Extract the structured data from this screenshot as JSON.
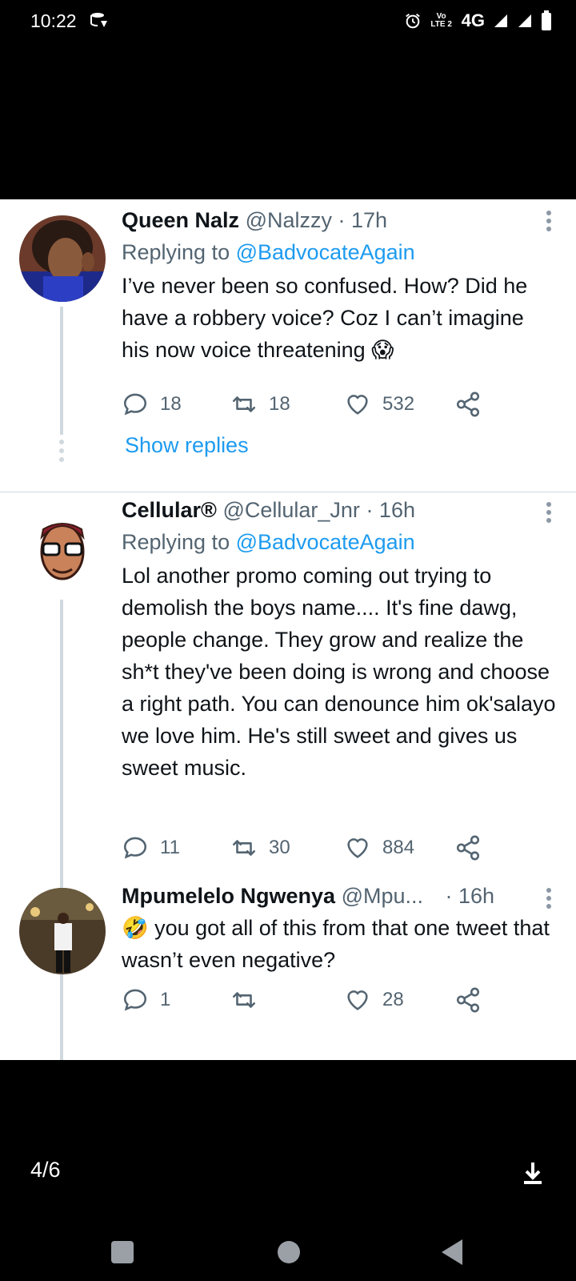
{
  "status_bar": {
    "time": "10:22",
    "volte_label": "Vo LTE 2",
    "network": "4G"
  },
  "tweets": [
    {
      "name": "Queen Nalz",
      "handle": "@Nalzzy",
      "time": "· 17h",
      "replying_prefix": "Replying to",
      "replying_handle": "@BadvocateAgain",
      "text": "I’ve never been so confused. How? Did he have a robbery voice? Coz I can’t imagine his now voice threatening 😱",
      "replies": "18",
      "retweets": "18",
      "likes": "532",
      "show_replies": "Show replies"
    },
    {
      "name": "Cellular®",
      "handle": "@Cellular_Jnr",
      "time": "· 16h",
      "replying_prefix": "Replying to",
      "replying_handle": "@BadvocateAgain",
      "text": "Lol another promo coming out trying to demolish the boys name.... It's fine dawg, people change. They grow and realize the sh*t they've been doing is wrong and choose a right path. You can denounce him ok'salayo we love him. He's still sweet and gives us sweet music.",
      "replies": "11",
      "retweets": "30",
      "likes": "884"
    },
    {
      "name": "Mpumelelo Ngwenya",
      "handle": "@Mpu...",
      "time": "· 16h",
      "text": "🤣 you got all of this from that one tweet that wasn’t even negative?",
      "replies": "1",
      "retweets": "",
      "likes": "28"
    }
  ],
  "viewer": {
    "pager": "4/6"
  },
  "icons": {
    "more": "more-vertical-icon",
    "reply": "reply-icon",
    "retweet": "retweet-icon",
    "like": "heart-icon",
    "share": "share-icon",
    "download": "download-icon"
  },
  "colors": {
    "link": "#1d9bf0",
    "secondary_text": "#536471",
    "thread_line": "#cfd9de"
  }
}
